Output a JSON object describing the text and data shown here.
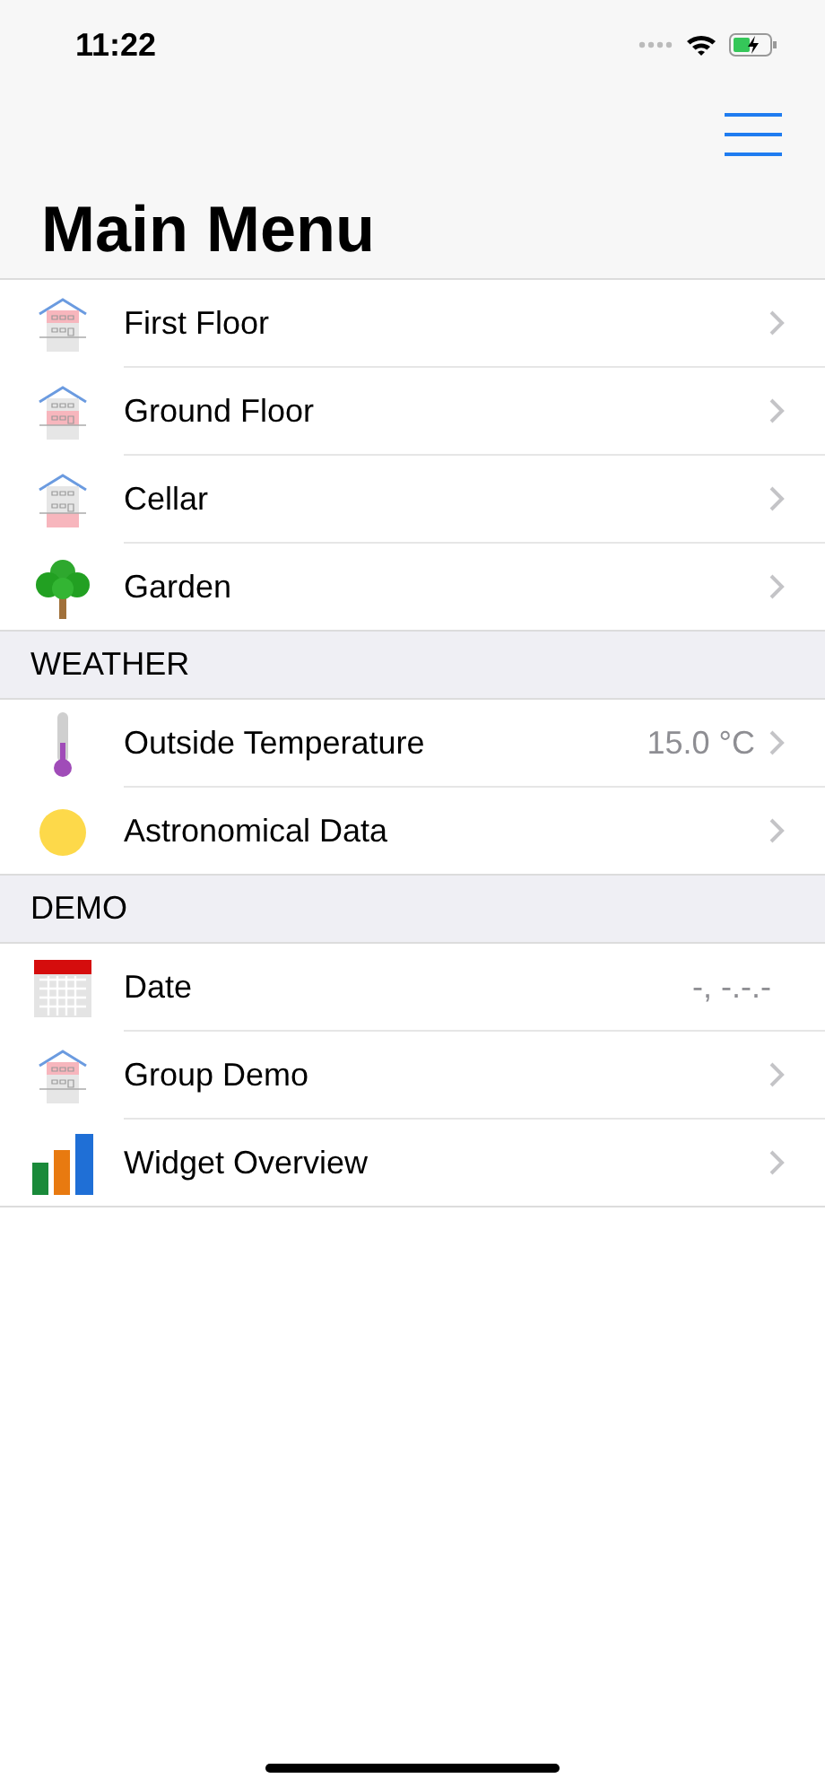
{
  "status_bar": {
    "time": "11:22"
  },
  "title": "Main Menu",
  "sections": [
    {
      "items": [
        {
          "kind": "house-top",
          "label": "First Floor",
          "chevron": true
        },
        {
          "kind": "house-middle",
          "label": "Ground Floor",
          "chevron": true
        },
        {
          "kind": "house-bottom",
          "label": "Cellar",
          "chevron": true
        },
        {
          "kind": "tree",
          "label": "Garden",
          "chevron": true
        }
      ]
    },
    {
      "header": "WEATHER",
      "items": [
        {
          "kind": "thermometer",
          "label": "Outside Temperature",
          "value": "15.0 °C",
          "chevron": true
        },
        {
          "kind": "sun",
          "label": "Astronomical Data",
          "chevron": true
        }
      ]
    },
    {
      "header": "DEMO",
      "items": [
        {
          "kind": "calendar",
          "label": "Date",
          "value": "-, -.-.-",
          "chevron": false
        },
        {
          "kind": "house-top",
          "label": "Group Demo",
          "chevron": true
        },
        {
          "kind": "chart",
          "label": "Widget Overview",
          "chevron": true
        }
      ]
    }
  ]
}
